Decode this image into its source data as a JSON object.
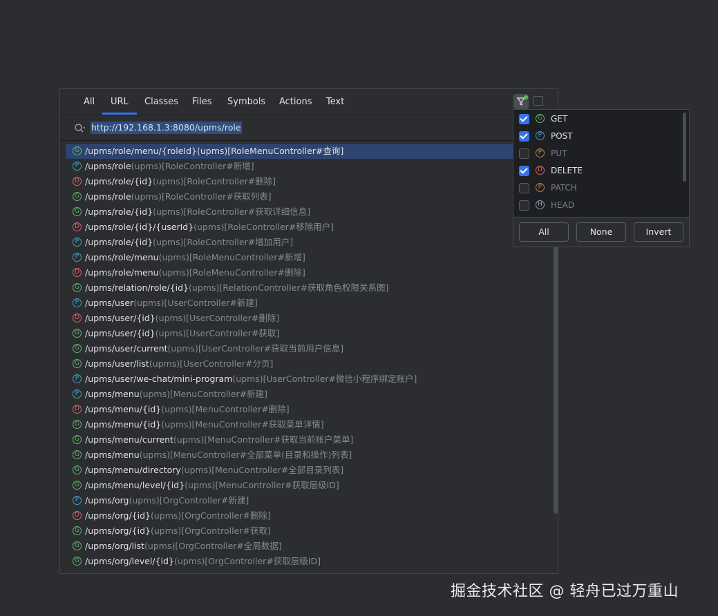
{
  "tabs": [
    "All",
    "URL",
    "Classes",
    "Files",
    "Symbols",
    "Actions",
    "Text"
  ],
  "active_tab": "URL",
  "search": {
    "value": "http://192.168.1.3:8080/upms/role"
  },
  "icons": {
    "search": "search-icon",
    "filter": "filter-icon",
    "collapse": "collapse-icon"
  },
  "results": [
    {
      "m": "G",
      "method": "GET",
      "path": "/upms/role/menu/{roleId}",
      "mod": "(upms)",
      "ctl": "[RoleMenuController#查询]",
      "selected": true
    },
    {
      "m": "P",
      "method": "POST",
      "path": "/upms/role",
      "mod": "(upms)",
      "ctl": "[RoleController#新增]"
    },
    {
      "m": "D",
      "method": "DELETE",
      "path": "/upms/role/{id}",
      "mod": "(upms)",
      "ctl": "[RoleController#删除]"
    },
    {
      "m": "G",
      "method": "GET",
      "path": "/upms/role",
      "mod": "(upms)",
      "ctl": "[RoleController#获取列表]"
    },
    {
      "m": "G",
      "method": "GET",
      "path": "/upms/role/{id}",
      "mod": "(upms)",
      "ctl": "[RoleController#获取详细信息]"
    },
    {
      "m": "D",
      "method": "DELETE",
      "path": "/upms/role/{id}/{userId}",
      "mod": "(upms)",
      "ctl": "[RoleController#移除用户]"
    },
    {
      "m": "P",
      "method": "POST",
      "path": "/upms/role/{id}",
      "mod": "(upms)",
      "ctl": "[RoleController#增加用户]"
    },
    {
      "m": "P",
      "method": "POST",
      "path": "/upms/role/menu",
      "mod": "(upms)",
      "ctl": "[RoleMenuController#新增]"
    },
    {
      "m": "D",
      "method": "DELETE",
      "path": "/upms/role/menu",
      "mod": "(upms)",
      "ctl": "[RoleMenuController#删除]"
    },
    {
      "m": "G",
      "method": "GET",
      "path": "/upms/relation/role/{id}",
      "mod": "(upms)",
      "ctl": "[RelationController#获取角色权限关系图]"
    },
    {
      "m": "P",
      "method": "POST",
      "path": "/upms/user",
      "mod": "(upms)",
      "ctl": "[UserController#新建]"
    },
    {
      "m": "D",
      "method": "DELETE",
      "path": "/upms/user/{id}",
      "mod": "(upms)",
      "ctl": "[UserController#删除]"
    },
    {
      "m": "G",
      "method": "GET",
      "path": "/upms/user/{id}",
      "mod": "(upms)",
      "ctl": "[UserController#获取]"
    },
    {
      "m": "G",
      "method": "GET",
      "path": "/upms/user/current",
      "mod": "(upms)",
      "ctl": "[UserController#获取当前用户信息]"
    },
    {
      "m": "G",
      "method": "GET",
      "path": "/upms/user/list",
      "mod": "(upms)",
      "ctl": "[UserController#分页]"
    },
    {
      "m": "P",
      "method": "POST",
      "path": "/upms/user/we-chat/mini-program",
      "mod": "(upms)",
      "ctl": "[UserController#微信小程序绑定账户]"
    },
    {
      "m": "P",
      "method": "POST",
      "path": "/upms/menu",
      "mod": "(upms)",
      "ctl": "[MenuController#新建]"
    },
    {
      "m": "D",
      "method": "DELETE",
      "path": "/upms/menu/{id}",
      "mod": "(upms)",
      "ctl": "[MenuController#删除]"
    },
    {
      "m": "G",
      "method": "GET",
      "path": "/upms/menu/{id}",
      "mod": "(upms)",
      "ctl": "[MenuController#获取菜单详情]"
    },
    {
      "m": "G",
      "method": "GET",
      "path": "/upms/menu/current",
      "mod": "(upms)",
      "ctl": "[MenuController#获取当前账户菜单]"
    },
    {
      "m": "G",
      "method": "GET",
      "path": "/upms/menu",
      "mod": "(upms)",
      "ctl": "[MenuController#全部菜单(目录和操作)列表]"
    },
    {
      "m": "G",
      "method": "GET",
      "path": "/upms/menu/directory",
      "mod": "(upms)",
      "ctl": "[MenuController#全部目录列表]"
    },
    {
      "m": "G",
      "method": "GET",
      "path": "/upms/menu/level/{id}",
      "mod": "(upms)",
      "ctl": "[MenuController#获取层级ID]"
    },
    {
      "m": "P",
      "method": "POST",
      "path": "/upms/org",
      "mod": "(upms)",
      "ctl": "[OrgController#新建]"
    },
    {
      "m": "D",
      "method": "DELETE",
      "path": "/upms/org/{id}",
      "mod": "(upms)",
      "ctl": "[OrgController#删除]"
    },
    {
      "m": "G",
      "method": "GET",
      "path": "/upms/org/{id}",
      "mod": "(upms)",
      "ctl": "[OrgController#获取]"
    },
    {
      "m": "G",
      "method": "GET",
      "path": "/upms/org/list",
      "mod": "(upms)",
      "ctl": "[OrgController#全局数据]"
    },
    {
      "m": "G",
      "method": "GET",
      "path": "/upms/org/level/{id}",
      "mod": "(upms)",
      "ctl": "[OrgController#获取层级ID]"
    }
  ],
  "filter": {
    "items": [
      {
        "m": "G",
        "name": "GET",
        "checked": true
      },
      {
        "m": "P",
        "name": "POST",
        "checked": true
      },
      {
        "m": "P",
        "name": "PUT",
        "checked": false
      },
      {
        "m": "D",
        "name": "DELETE",
        "checked": true
      },
      {
        "m": "P",
        "name": "PATCH",
        "checked": false
      },
      {
        "m": "H",
        "name": "HEAD",
        "checked": false
      }
    ],
    "buttons": {
      "all": "All",
      "none": "None",
      "invert": "Invert"
    }
  },
  "colors": {
    "accent": "#3574f0",
    "get": "#5fb865",
    "post": "#3ea1c8",
    "delete": "#e06060",
    "put": "#d4a23b",
    "patch": "#e08a3c",
    "head": "#a8a8d6"
  },
  "watermark": "掘金技术社区 @ 轻舟已过万重山"
}
